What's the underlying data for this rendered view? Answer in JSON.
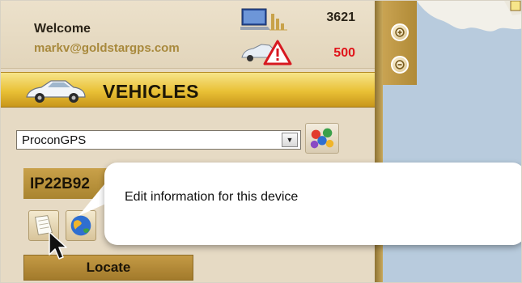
{
  "header": {
    "welcome": "Welcome",
    "email": "markv@goldstargps.com",
    "active_count": "3621",
    "alert_count": "500",
    "icons": [
      "laptop-icon",
      "car-alert-icon"
    ]
  },
  "vehicles_bar": {
    "title": "VEHICLES",
    "icon": "car-icon"
  },
  "group_select": {
    "value": "ProconGPS",
    "arrow": "▼"
  },
  "device": {
    "id": "IP22B92"
  },
  "buttons": {
    "edit": "edit-device-icon",
    "globe": "globe-icon",
    "locate": "Locate"
  },
  "tooltip": {
    "text": "Edit information for this device"
  },
  "map": {
    "zoom_in": "zoom-in-icon",
    "zoom_out": "zoom-out-icon"
  },
  "colors": {
    "panel": "#e6dac4",
    "gold": "#e9c035",
    "accent_text": "#a8893c",
    "alert": "#e0141a",
    "water": "#b8cbdd"
  }
}
